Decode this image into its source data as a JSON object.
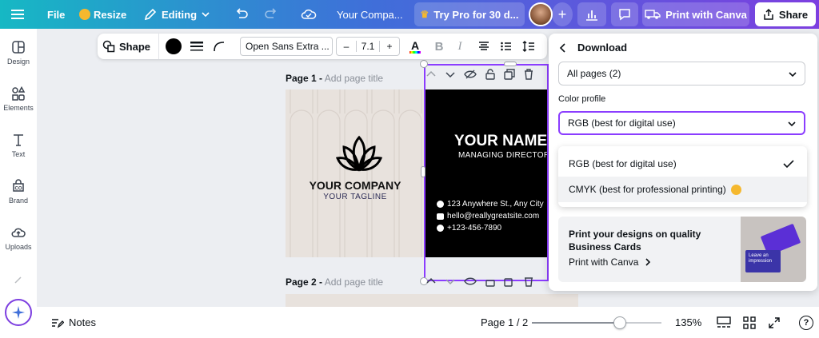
{
  "topbar": {
    "file": "File",
    "resize": "Resize",
    "editing": "Editing",
    "doc_title": "Your Compa...",
    "try_pro": "Try Pro for 30 d...",
    "print_canva": "Print with Canva",
    "share": "Share"
  },
  "sidebar": {
    "items": [
      {
        "label": "Design",
        "icon": "design-icon"
      },
      {
        "label": "Elements",
        "icon": "elements-icon"
      },
      {
        "label": "Text",
        "icon": "text-icon"
      },
      {
        "label": "Brand",
        "icon": "brand-icon"
      },
      {
        "label": "Uploads",
        "icon": "uploads-icon"
      }
    ]
  },
  "toolbar": {
    "shape": "Shape",
    "font": "Open Sans Extra ...",
    "minus": "–",
    "font_size": "7.1",
    "plus": "+",
    "bold": "B",
    "italic": "I"
  },
  "canvas": {
    "page1_label": "Page 1 -",
    "page1_title_placeholder": "Add page title",
    "page2_label": "Page 2 -",
    "page2_title_placeholder": "Add page title"
  },
  "card_front": {
    "company": "YOUR COMPANY",
    "tagline": "YOUR TAGLINE"
  },
  "card_back": {
    "name": "YOUR NAME",
    "role": "MANAGING DIRECTOR",
    "address": "123 Anywhere St., Any City",
    "email": "hello@reallygreatsite.com",
    "phone": "+123-456-7890"
  },
  "download_panel": {
    "title": "Download",
    "pages_value": "All pages (2)",
    "color_profile_label": "Color profile",
    "color_profile_value": "RGB (best for digital use)",
    "options": [
      {
        "label": "RGB (best for digital use)",
        "selected": true
      },
      {
        "label": "CMYK (best for professional printing)",
        "selected": false
      }
    ],
    "promo_title": "Print your designs on quality Business Cards",
    "promo_link": "Print with Canva",
    "promo_card_text": "Leave an impression"
  },
  "bottombar": {
    "notes": "Notes",
    "page_indicator": "Page 1 / 2",
    "zoom": "135%",
    "zoom_fraction": 0.68,
    "help": "?"
  },
  "colors": {
    "accent": "#8b3dff",
    "topbar_start": "#16b8c4",
    "topbar_end": "#7d3fe0",
    "crown": "#f5b82e"
  }
}
